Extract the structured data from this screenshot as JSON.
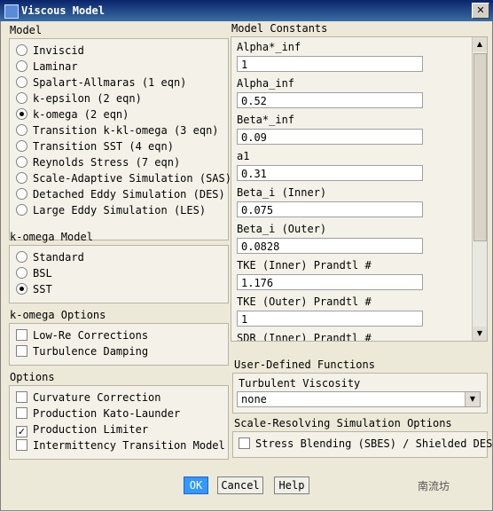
{
  "window": {
    "title": "Viscous Model",
    "close_label": "✕"
  },
  "model": {
    "title": "Model",
    "options": [
      {
        "label": "Inviscid",
        "selected": false
      },
      {
        "label": "Laminar",
        "selected": false
      },
      {
        "label": "Spalart-Allmaras (1 eqn)",
        "selected": false
      },
      {
        "label": "k-epsilon (2 eqn)",
        "selected": false
      },
      {
        "label": "k-omega (2 eqn)",
        "selected": true
      },
      {
        "label": "Transition k-kl-omega (3 eqn)",
        "selected": false
      },
      {
        "label": "Transition SST (4 eqn)",
        "selected": false
      },
      {
        "label": "Reynolds Stress (7 eqn)",
        "selected": false
      },
      {
        "label": "Scale-Adaptive Simulation (SAS)",
        "selected": false
      },
      {
        "label": "Detached Eddy Simulation (DES)",
        "selected": false
      },
      {
        "label": "Large Eddy Simulation (LES)",
        "selected": false
      }
    ]
  },
  "komega_model": {
    "title": "k-omega Model",
    "options": [
      {
        "label": "Standard",
        "selected": false
      },
      {
        "label": "BSL",
        "selected": false
      },
      {
        "label": "SST",
        "selected": true
      }
    ]
  },
  "komega_options": {
    "title": "k-omega Options",
    "options": [
      {
        "label": "Low-Re Corrections",
        "checked": false
      },
      {
        "label": "Turbulence Damping",
        "checked": false
      }
    ]
  },
  "options": {
    "title": "Options",
    "options": [
      {
        "label": "Curvature Correction",
        "checked": false
      },
      {
        "label": "Production Kato-Launder",
        "checked": false
      },
      {
        "label": "Production Limiter",
        "checked": true
      },
      {
        "label": "Intermittency Transition Model",
        "checked": false
      }
    ]
  },
  "model_constants": {
    "title": "Model Constants",
    "items": [
      {
        "label": "Alpha*_inf",
        "value": "1"
      },
      {
        "label": "Alpha_inf",
        "value": "0.52"
      },
      {
        "label": "Beta*_inf",
        "value": "0.09"
      },
      {
        "label": "a1",
        "value": "0.31"
      },
      {
        "label": "Beta_i (Inner)",
        "value": "0.075"
      },
      {
        "label": "Beta_i (Outer)",
        "value": "0.0828"
      },
      {
        "label": "TKE (Inner) Prandtl #",
        "value": "1.176"
      },
      {
        "label": "TKE (Outer) Prandtl #",
        "value": "1"
      },
      {
        "label": "SDR (Inner) Prandtl #",
        "value": ""
      }
    ]
  },
  "udf": {
    "title": "User-Defined Functions",
    "turb_visc_label": "Turbulent Viscosity",
    "turb_visc_value": "none"
  },
  "srs": {
    "title": "Scale-Resolving Simulation Options",
    "stress_blending_label": "Stress Blending (SBES) / Shielded DES",
    "stress_blending_checked": false
  },
  "buttons": {
    "ok": "OK",
    "cancel": "Cancel",
    "help": "Help"
  },
  "watermark": "南流坊",
  "icons": {
    "scroll_up": "▲",
    "scroll_down": "▼",
    "dropdown": "▼",
    "check_mark": "✓"
  }
}
